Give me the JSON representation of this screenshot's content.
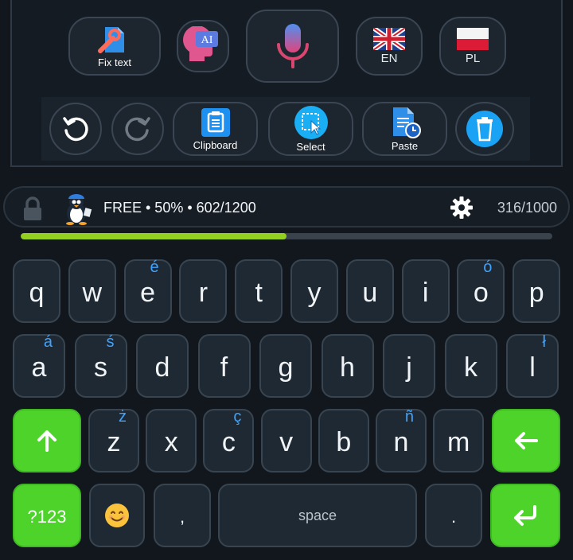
{
  "toolbar": {
    "fix_text_label": "Fix text",
    "ai_label": "AI",
    "lang1_label": "EN",
    "lang2_label": "PL",
    "clipboard_label": "Clipboard",
    "select_label": "Select",
    "paste_label": "Paste"
  },
  "status": {
    "plan_text": "FREE • 50% • 602/1200",
    "usage_progress": 0.5,
    "char_count": "316/1000"
  },
  "keyboard": {
    "row1": [
      {
        "key": "q",
        "alt": ""
      },
      {
        "key": "w",
        "alt": ""
      },
      {
        "key": "e",
        "alt": "é"
      },
      {
        "key": "r",
        "alt": ""
      },
      {
        "key": "t",
        "alt": ""
      },
      {
        "key": "y",
        "alt": ""
      },
      {
        "key": "u",
        "alt": ""
      },
      {
        "key": "i",
        "alt": ""
      },
      {
        "key": "o",
        "alt": "ó"
      },
      {
        "key": "p",
        "alt": ""
      }
    ],
    "row2": [
      {
        "key": "a",
        "alt": "á"
      },
      {
        "key": "s",
        "alt": "ś"
      },
      {
        "key": "d",
        "alt": ""
      },
      {
        "key": "f",
        "alt": ""
      },
      {
        "key": "g",
        "alt": ""
      },
      {
        "key": "h",
        "alt": ""
      },
      {
        "key": "j",
        "alt": ""
      },
      {
        "key": "k",
        "alt": ""
      },
      {
        "key": "l",
        "alt": "ł"
      }
    ],
    "row3": [
      {
        "key": "z",
        "alt": "ż"
      },
      {
        "key": "x",
        "alt": ""
      },
      {
        "key": "c",
        "alt": "ç"
      },
      {
        "key": "v",
        "alt": ""
      },
      {
        "key": "b",
        "alt": ""
      },
      {
        "key": "n",
        "alt": "ñ"
      },
      {
        "key": "m",
        "alt": ""
      }
    ],
    "symbols_label": "?123",
    "comma_label": ",",
    "space_label": "space",
    "period_label": "."
  },
  "colors": {
    "accent_green": "#4dd32a",
    "progress_green": "#93cf1f",
    "alt_char_blue": "#3da3ff",
    "key_bg": "#1f2933"
  }
}
